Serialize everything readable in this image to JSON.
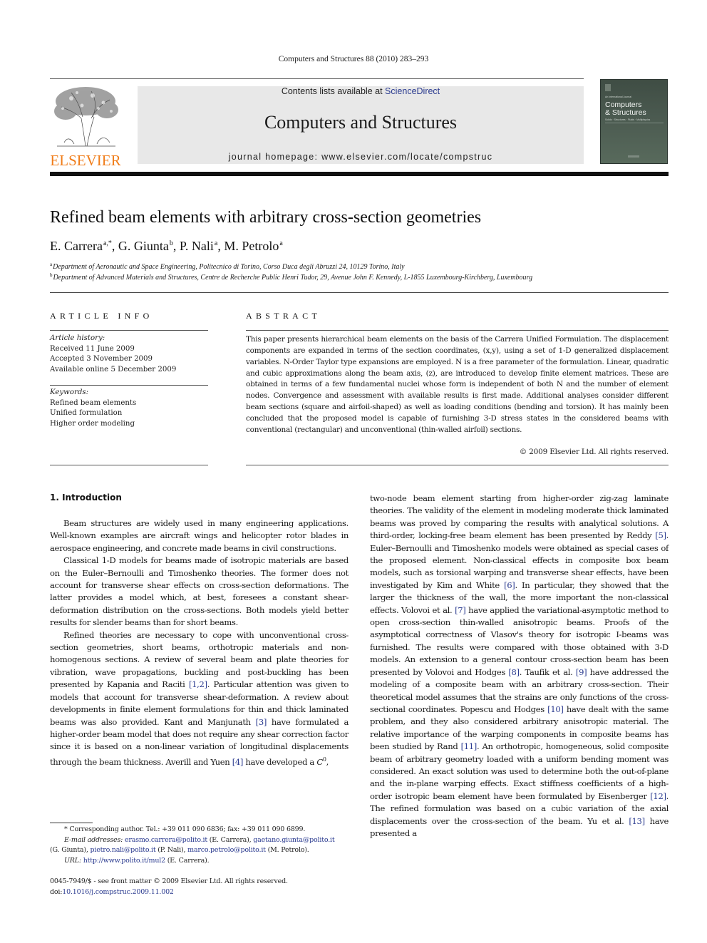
{
  "running_head": "Computers and Structures 88 (2010) 283–293",
  "publisher": {
    "logo_word": "ELSEVIER",
    "logo_color": "#f07d1a"
  },
  "banner": {
    "contents_prefix": "Contents lists available at ",
    "contents_link": "ScienceDirect",
    "journal_name": "Computers and Structures",
    "homepage": "journal homepage: www.elsevier.com/locate/compstruc",
    "background": "#e8e8e8"
  },
  "cover": {
    "tagline": "An International Journal",
    "title_line1": "Computers",
    "title_line2": "& Structures",
    "subtitle": "Solids · Structures · Fluids · Multiphysics"
  },
  "article": {
    "title": "Refined beam elements with arbitrary cross-section geometries",
    "authors": [
      {
        "name": "E. Carrera",
        "sup": "a,*"
      },
      {
        "name": "G. Giunta",
        "sup": "b"
      },
      {
        "name": "P. Nali",
        "sup": "a"
      },
      {
        "name": "M. Petrolo",
        "sup": "a"
      }
    ],
    "affiliations": [
      {
        "key": "a",
        "text": "Department of Aeronautic and Space Engineering, Politecnico di Torino, Corso Duca degli Abruzzi 24, 10129 Torino, Italy"
      },
      {
        "key": "b",
        "text": "Department of Advanced Materials and Structures, Centre de Recherche Public Henri Tudor, 29, Avenue John F. Kennedy, L-1855 Luxembourg-Kirchberg, Luxembourg"
      }
    ]
  },
  "article_info": {
    "heading": "ARTICLE INFO",
    "history_label": "Article history:",
    "history": [
      "Received 11 June 2009",
      "Accepted 3 November 2009",
      "Available online 5 December 2009"
    ],
    "keywords_label": "Keywords:",
    "keywords": [
      "Refined beam elements",
      "Unified formulation",
      "Higher order modeling"
    ]
  },
  "abstract": {
    "heading": "ABSTRACT",
    "text": "This paper presents hierarchical beam elements on the basis of the Carrera Unified Formulation. The displacement components are expanded in terms of the section coordinates, (x,y), using a set of 1-D generalized displacement variables. N-Order Taylor type expansions are employed. N is a free parameter of the formulation. Linear, quadratic and cubic approximations along the beam axis, (z), are introduced to develop finite element matrices. These are obtained in terms of a few fundamental nuclei whose form is independent of both N and the number of element nodes. Convergence and assessment with available results is first made. Additional analyses consider different beam sections (square and airfoil-shaped) as well as loading conditions (bending and torsion). It has mainly been concluded that the proposed model is capable of furnishing 3-D stress states in the considered beams with conventional (rectangular) and unconventional (thin-walled airfoil) sections.",
    "copyright": "© 2009 Elsevier Ltd. All rights reserved."
  },
  "introduction": {
    "heading": "1. Introduction",
    "left_paragraphs": [
      [
        "Beam structures are widely used in many engineering applications. Well-known examples are aircraft wings and helicopter rotor blades in aerospace engineering, and concrete made beams in civil constructions."
      ],
      [
        "Classical 1-D models for beams made of isotropic materials are based on the Euler–Bernoulli and Timoshenko theories. The former does not account for transverse shear effects on cross-section deformations. The latter provides a model which, at best, foresees a constant shear-deformation distribution on the cross-sections. Both models yield better results for slender beams than for short beams."
      ],
      [
        "Refined theories are necessary to cope with unconventional cross-section geometries, short beams, orthotropic materials and non-homogenous sections. A review of several beam and plate theories for vibration, wave propagations, buckling and post-buckling has been presented by Kapania and Raciti ",
        "[1,2]",
        ". Particular attention was given to models that account for transverse shear-deformation. A review about developments in finite element formulations for thin and thick laminated beams was also provided. Kant and Manjunath ",
        "[3]",
        " have formulated a higher-order beam model that does not require any shear correction factor since it is based on a non-linear variation of longitudinal displacements through the beam thickness. Averill and Yuen ",
        "[4]",
        " have developed a C",
        "0",
        ","
      ]
    ],
    "right_segments": [
      "two-node beam element starting from higher-order zig-zag laminate theories. The validity of the element in modeling moderate thick laminated beams was proved by comparing the results with analytical solutions. A third-order, locking-free beam element has been presented by Reddy ",
      "[5]",
      ". Euler–Bernoulli and Timoshenko models were obtained as special cases of the proposed element. Non-classical effects in composite box beam models, such as torsional warping and transverse shear effects, have been investigated by Kim and White ",
      "[6]",
      ". In particular, they showed that the larger the thickness of the wall, the more important the non-classical effects. Volovoi et al. ",
      "[7]",
      " have applied the variational-asymptotic method to open cross-section thin-walled anisotropic beams. Proofs of the asymptotical correctness of Vlasov's theory for isotropic I-beams was furnished. The results were compared with those obtained with 3-D models. An extension to a general contour cross-section beam has been presented by Volovoi and Hodges ",
      "[8]",
      ". Taufik et al. ",
      "[9]",
      " have addressed the modeling of a composite beam with an arbitrary cross-section. Their theoretical model assumes that the strains are only functions of the cross-sectional coordinates. Popescu and Hodges ",
      "[10]",
      " have dealt with the same problem, and they also considered arbitrary anisotropic material. The relative importance of the warping components in composite beams has been studied by Rand ",
      "[11]",
      ". An orthotropic, homogeneous, solid composite beam of arbitrary geometry loaded with a uniform bending moment was considered. An exact solution was used to determine both the out-of-plane and the in-plane warping effects. Exact stiffness coefficients of a high-order isotropic beam element have been formulated by Eisenberger ",
      "[12]",
      ". The refined formulation was based on a cubic variation of the axial displacements over the cross-section of the beam. Yu et al. ",
      "[13]",
      " have presented a"
    ]
  },
  "footnotes": {
    "corresponding": "* Corresponding author. Tel.: +39 011 090 6836; fax: +39 011 090 6899.",
    "email_label": "E-mail addresses:",
    "emails": [
      {
        "addr": "erasmo.carrera@polito.it",
        "who": " (E. Carrera), "
      },
      {
        "addr": "gaetano.giunta@polito.it",
        "who": " (G. Giunta), "
      },
      {
        "addr": "pietro.nali@polito.it",
        "who": " (P. Nali), "
      },
      {
        "addr": "marco.petrolo@polito.it",
        "who": " (M. Petrolo)."
      }
    ],
    "url_label": "URL:",
    "url": "http://www.polito.it/mul2",
    "url_who": " (E. Carrera).",
    "front_matter": "0045-7949/$ - see front matter © 2009 Elsevier Ltd. All rights reserved.",
    "doi_prefix": "doi:",
    "doi": "10.1016/j.compstruc.2009.11.002"
  },
  "colors": {
    "link": "#2a3a8f",
    "rule": "#111111"
  }
}
